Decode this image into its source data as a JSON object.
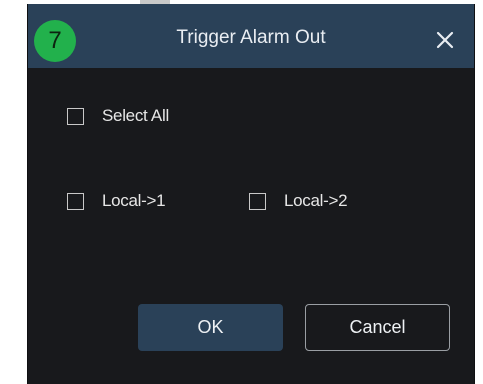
{
  "dialog": {
    "step_number": "7",
    "title": "Trigger Alarm Out",
    "close_icon": "close-icon"
  },
  "options": {
    "select_all": {
      "label": "Select All",
      "checked": false
    },
    "outputs": [
      {
        "label": "Local->1",
        "checked": false
      },
      {
        "label": "Local->2",
        "checked": false
      }
    ]
  },
  "buttons": {
    "ok_label": "OK",
    "cancel_label": "Cancel"
  },
  "colors": {
    "titlebar": "#2a4158",
    "dialog_bg": "#18191c",
    "badge": "#22b14c",
    "text": "#e6e6e6"
  }
}
